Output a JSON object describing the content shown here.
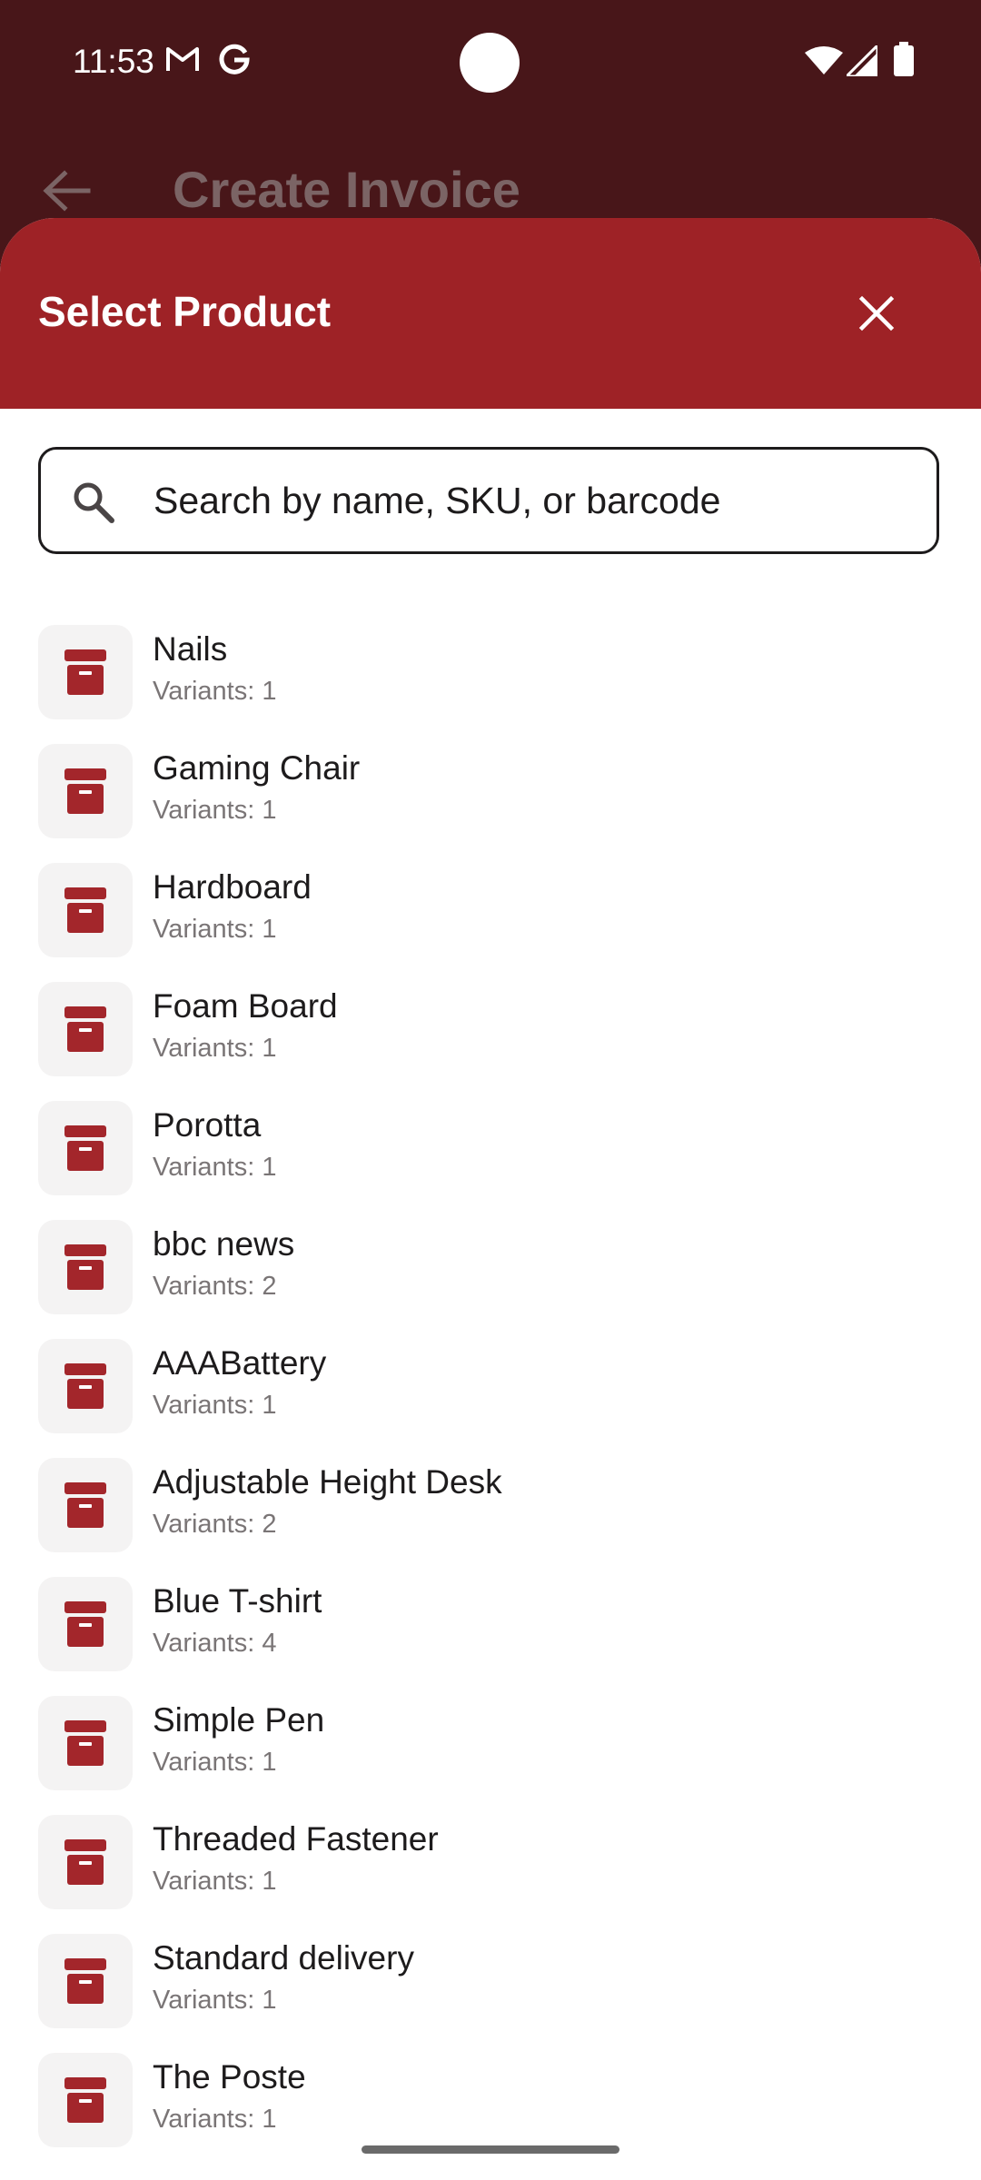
{
  "status_bar": {
    "time": "11:53",
    "notification_icons": [
      "gmail-icon",
      "google-icon"
    ],
    "system_icons": [
      "wifi-icon",
      "signal-icon",
      "battery-icon"
    ]
  },
  "app_bar": {
    "title": "Create Invoice",
    "back_icon": "arrow-back-icon"
  },
  "sheet": {
    "title": "Select Product",
    "close_icon": "close-icon",
    "search": {
      "placeholder": "Search by name, SKU, or barcode",
      "value": ""
    },
    "products": [
      {
        "name": "Nails",
        "variants": "Variants: 1"
      },
      {
        "name": "Gaming Chair",
        "variants": "Variants: 1"
      },
      {
        "name": "Hardboard",
        "variants": "Variants: 1"
      },
      {
        "name": "Foam Board",
        "variants": "Variants: 1"
      },
      {
        "name": "Porotta",
        "variants": "Variants: 1"
      },
      {
        "name": "bbc news",
        "variants": "Variants: 2"
      },
      {
        "name": "AAABattery",
        "variants": "Variants: 1"
      },
      {
        "name": "Adjustable Height Desk",
        "variants": "Variants: 2"
      },
      {
        "name": "Blue T-shirt",
        "variants": "Variants: 4"
      },
      {
        "name": "Simple Pen",
        "variants": "Variants: 1"
      },
      {
        "name": "Threaded Fastener",
        "variants": "Variants: 1"
      },
      {
        "name": "Standard delivery",
        "variants": "Variants: 1"
      },
      {
        "name": "The Poste",
        "variants": "Variants: 1"
      }
    ],
    "product_icon": "archive-box-icon"
  },
  "colors": {
    "header_bg": "#9e2226",
    "status_bar_bg": "#481619",
    "icon_red": "#a3262b",
    "thumb_bg": "#f4f3f3"
  }
}
